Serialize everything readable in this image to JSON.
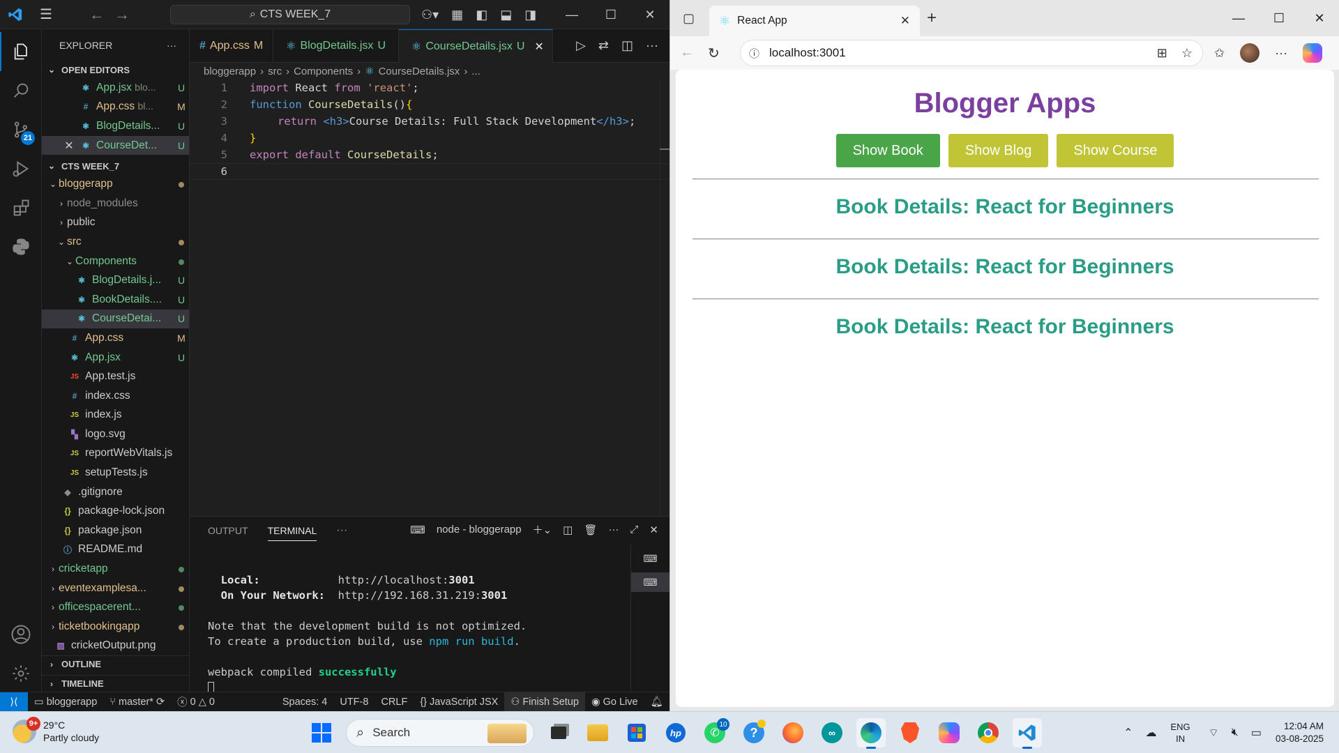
{
  "vscode": {
    "search_text": "CTS WEEK_7",
    "explorer_label": "EXPLORER",
    "open_editors_label": "OPEN EDITORS",
    "open_editors": [
      {
        "name": "App.jsx",
        "hint": "blo...",
        "status": "U"
      },
      {
        "name": "App.css",
        "hint": "bl...",
        "status": "M"
      },
      {
        "name": "BlogDetails...",
        "hint": "",
        "status": "U"
      },
      {
        "name": "CourseDet...",
        "hint": "",
        "status": "U"
      }
    ],
    "workspace_label": "CTS WEEK_7",
    "tree": {
      "bloggerapp": "bloggerapp",
      "node_modules": "node_modules",
      "public": "public",
      "src": "src",
      "components": "Components",
      "blogdetails": "BlogDetails.j...",
      "bookdetails": "BookDetails....",
      "coursedetails": "CourseDetai...",
      "appcss": "App.css",
      "appjsx": "App.jsx",
      "apptest": "App.test.js",
      "indexcss": "index.css",
      "indexjs": "index.js",
      "logo": "logo.svg",
      "reportweb": "reportWebVitals.js",
      "setuptests": "setupTests.js",
      "gitignore": ".gitignore",
      "packagelock": "package-lock.json",
      "packagejson": "package.json",
      "readme": "README.md",
      "cricketapp": "cricketapp",
      "eventexamples": "eventexamplesa...",
      "officespace": "officespacerent...",
      "ticketbooking": "ticketbookingapp",
      "cricketoutput": "cricketOutput.png"
    },
    "status_u": "U",
    "status_m": "M",
    "outline_label": "OUTLINE",
    "timeline_label": "TIMELINE",
    "tabs": [
      {
        "name": "App.css",
        "status": "M"
      },
      {
        "name": "BlogDetails.jsx",
        "status": "U"
      },
      {
        "name": "CourseDetails.jsx",
        "status": "U"
      }
    ],
    "breadcrumb": [
      "bloggerapp",
      "src",
      "Components",
      "CourseDetails.jsx",
      "..."
    ],
    "code": {
      "l1_import": "import",
      "l1_react": "React",
      "l1_from": "from",
      "l1_str": "'react'",
      "l1_semi": ";",
      "l2_function": "function",
      "l2_name": "CourseDetails",
      "l2_parens": "()",
      "l2_brace": "{",
      "l3_return": "return",
      "l3_open_tag": "<h3>",
      "l3_text": "Course Details: Full Stack Development",
      "l3_close_tag": "</h3>",
      "l3_semi": ";",
      "l4_brace": "}",
      "l5_export": "export",
      "l5_default": "default",
      "l5_name": "CourseDetails",
      "l5_semi": ";"
    },
    "line_numbers": [
      "1",
      "2",
      "3",
      "4",
      "5",
      "6"
    ],
    "panel_tabs": {
      "output": "OUTPUT",
      "terminal": "TERMINAL"
    },
    "terminal_name": "node - bloggerapp",
    "terminal": {
      "local_label": "Local:",
      "local_url": "http://localhost:",
      "local_port": "3001",
      "network_label": "On Your Network:",
      "network_url": "http://192.168.31.219:",
      "network_port": "3001",
      "note1": "Note that the development build is not optimized.",
      "note2_pre": "To create a production build, use ",
      "note2_cmd": "npm run build",
      "note2_post": ".",
      "compiled_pre": "webpack compiled ",
      "compiled_word": "successfully"
    },
    "status": {
      "folder": "bloggerapp",
      "branch": "master*",
      "errors": "0",
      "warnings": "0",
      "spaces": "Spaces: 4",
      "encoding": "UTF-8",
      "eol": "CRLF",
      "language": "JavaScript JSX",
      "finish_setup": "Finish Setup",
      "go_live": "Go Live"
    },
    "scm_badge": "21"
  },
  "browser": {
    "tab_title": "React App",
    "url": "localhost:3001",
    "page": {
      "title": "Blogger Apps",
      "buttons": [
        "Show Book",
        "Show Blog",
        "Show Course"
      ],
      "details": [
        "Book Details: React for Beginners",
        "Book Details: React for Beginners",
        "Book Details: React for Beginners"
      ],
      "colors": {
        "title": "#7b3fa0",
        "active_button": "#4aa548",
        "button": "#c0c435",
        "details": "#2a9d86"
      }
    }
  },
  "taskbar": {
    "temperature": "29°C",
    "weather": "Partly cloudy",
    "weather_badge": "9+",
    "search_label": "Search",
    "whatsapp_badge": "10",
    "lang_top": "ENG",
    "lang_bottom": "IN",
    "time": "12:04 AM",
    "date": "03-08-2025"
  }
}
